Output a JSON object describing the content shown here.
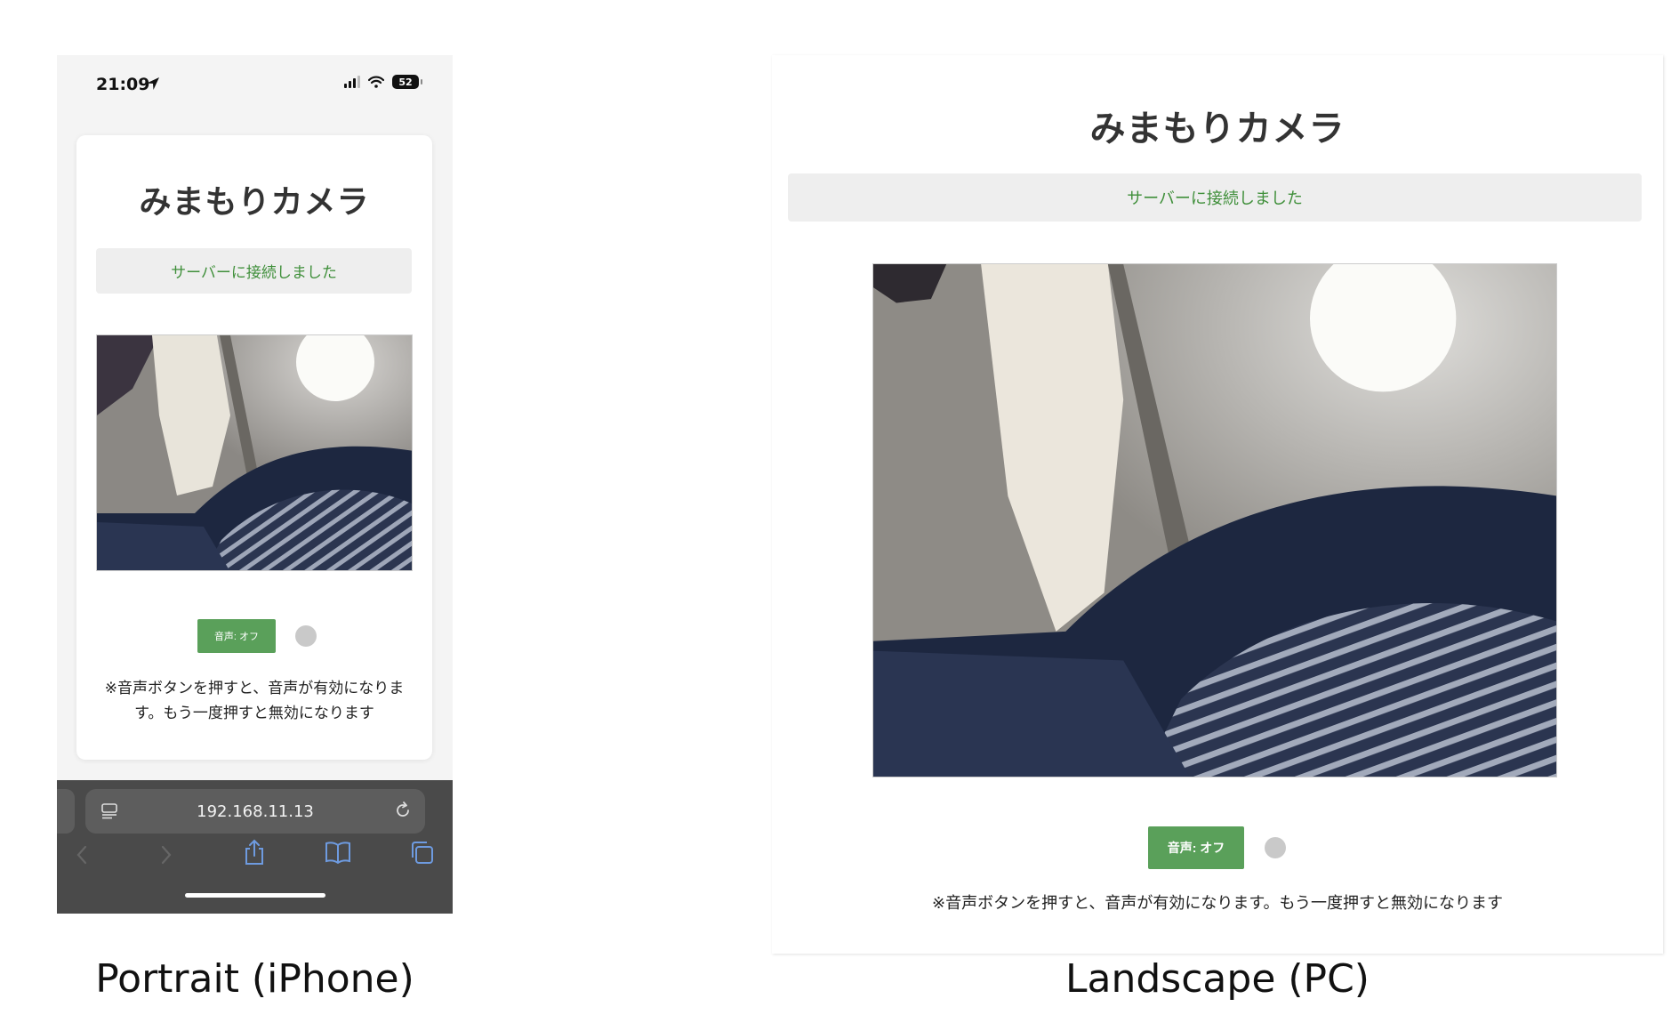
{
  "captions": {
    "portrait": "Portrait (iPhone)",
    "landscape": "Landscape (PC)"
  },
  "phone": {
    "status_bar": {
      "time": "21:09",
      "battery": "52",
      "icons": [
        "location-arrow-icon",
        "signal-icon",
        "wifi-icon",
        "battery-icon"
      ]
    },
    "app": {
      "title": "みまもりカメラ",
      "connection_status": "サーバーに接続しました",
      "audio_button": "音声: オフ",
      "note": "※音声ボタンを押すと、音声が有効になります。もう一度押すと無効になります"
    },
    "safari": {
      "url": "192.168.11.13",
      "icons": [
        "page-menu-icon",
        "reload-icon",
        "back-icon",
        "forward-icon",
        "share-icon",
        "bookmarks-icon",
        "tabs-icon"
      ]
    }
  },
  "pc": {
    "app": {
      "title": "みまもりカメラ",
      "connection_status": "サーバーに接続しました",
      "audio_button": "音声: オフ",
      "note": "※音声ボタンを押すと、音声が有効になります。もう一度押すと無効になります"
    }
  },
  "colors": {
    "status_text": "#3f8f3a",
    "audio_button_bg": "#5aa05a",
    "indicator_dot": "#c9c9c9",
    "safari_toolbar": "#4a4a4a",
    "safari_icon": "#6e9be0"
  }
}
